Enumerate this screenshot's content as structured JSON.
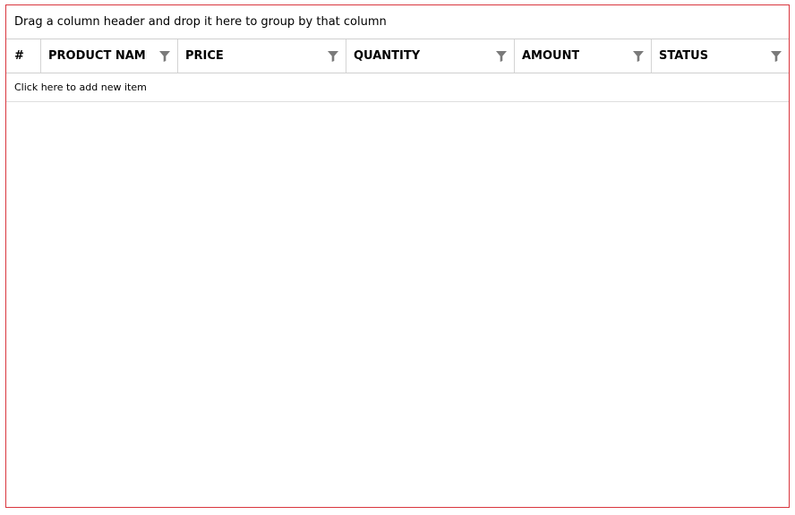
{
  "group_panel": {
    "text": "Drag a column header and drop it here to group by that column"
  },
  "columns": [
    {
      "label": "#",
      "filterable": false
    },
    {
      "label": "PRODUCT NAME",
      "filterable": true
    },
    {
      "label": "PRICE",
      "filterable": true
    },
    {
      "label": "QUANTITY",
      "filterable": true
    },
    {
      "label": "AMOUNT",
      "filterable": true
    },
    {
      "label": "STATUS",
      "filterable": true
    }
  ],
  "add_row": {
    "text": "Click here to add new item"
  },
  "rows": [],
  "icons": {
    "filter": "filter-funnel-icon"
  },
  "colors": {
    "border_accent": "#d9363e",
    "filter_icon": "#7a7a7a"
  }
}
